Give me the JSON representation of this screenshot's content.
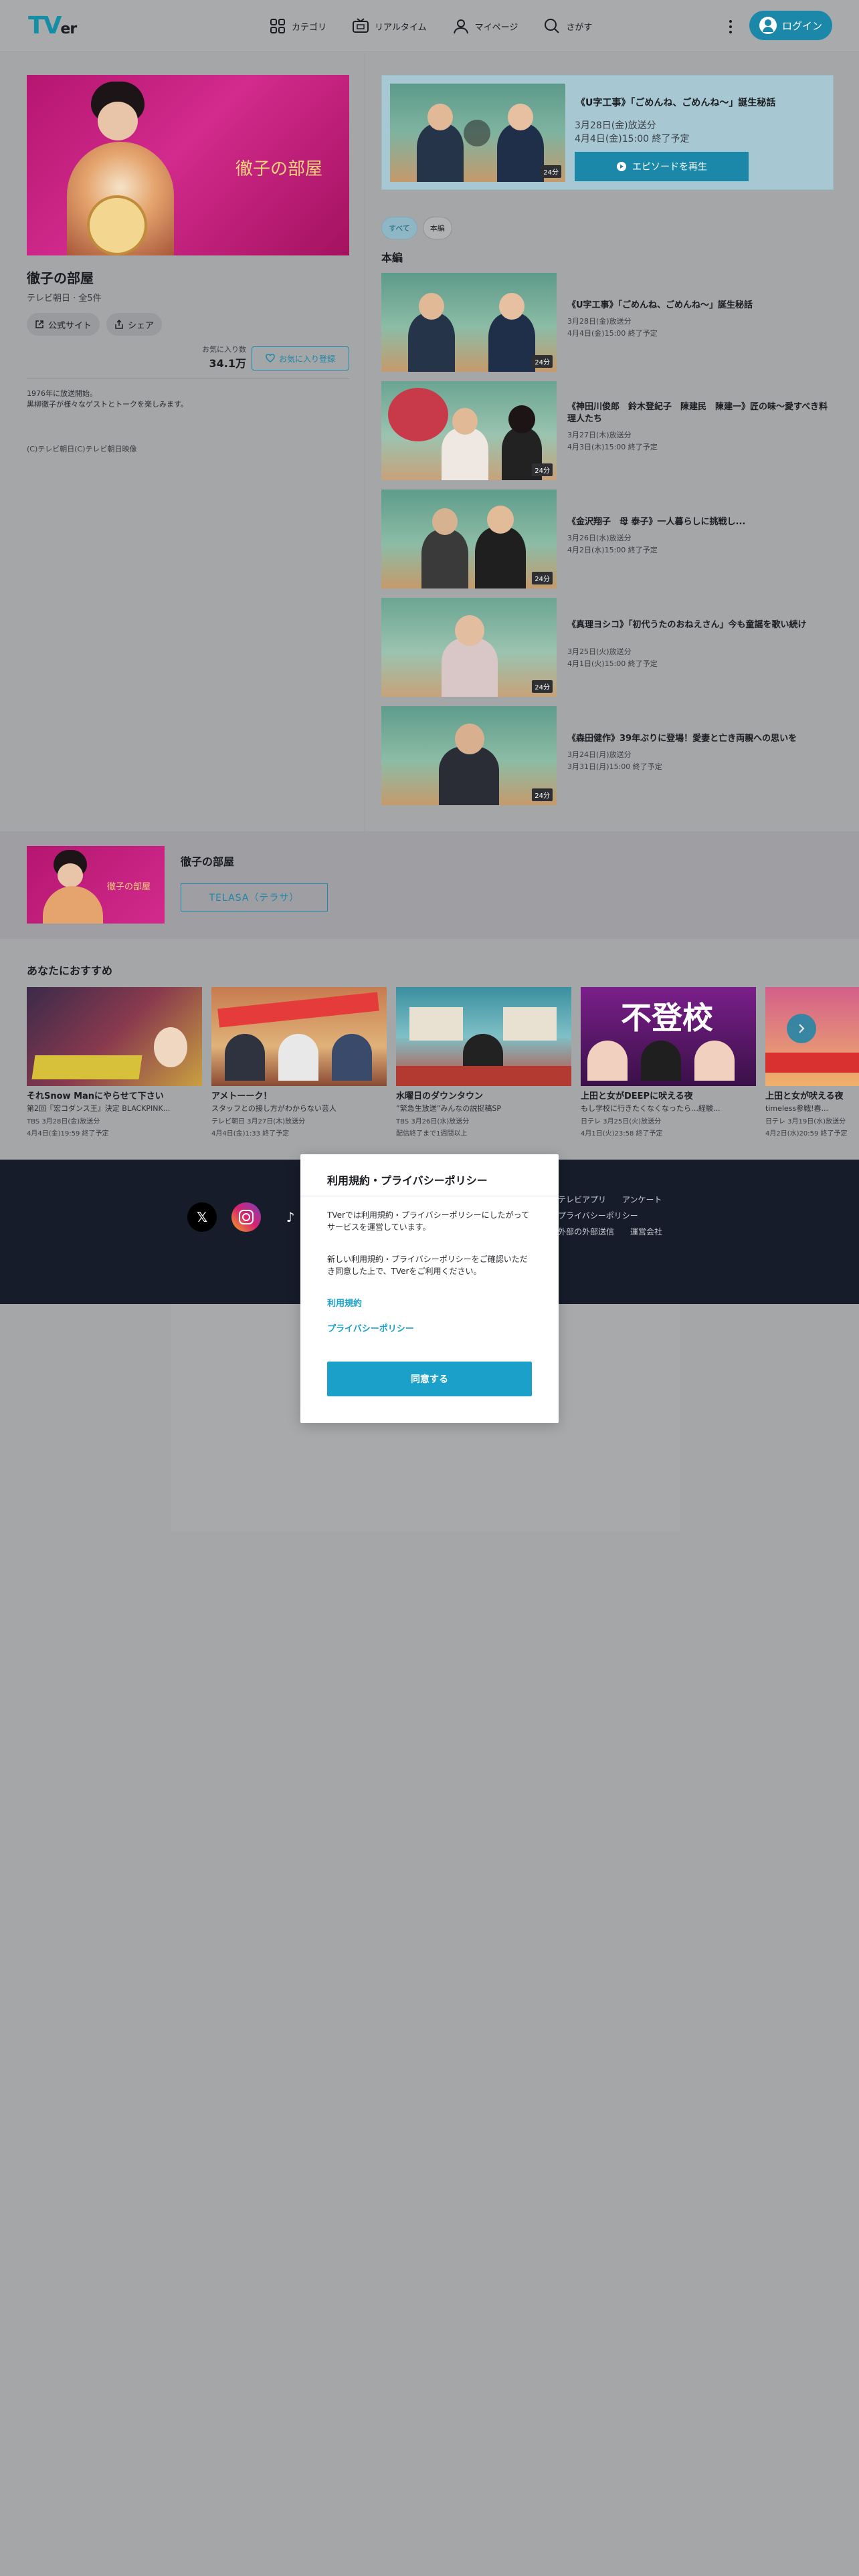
{
  "header": {
    "logo": "TV",
    "logo_tail": "er",
    "nav": [
      {
        "label": "カテゴリ",
        "icon": "category-icon"
      },
      {
        "label": "リアルタイム",
        "icon": "tv-icon"
      },
      {
        "label": "マイページ",
        "icon": "user-icon"
      },
      {
        "label": "さがす",
        "icon": "search-icon"
      }
    ],
    "login_label": "ログイン"
  },
  "program": {
    "hero_title": "徹子の部屋",
    "title": "徹子の部屋",
    "subtitle": "テレビ朝日 · 全5件",
    "official_label": "公式サイト",
    "share_label": "シェア",
    "fav_count_label": "お気に入り数",
    "fav_count": "34.1万",
    "fav_button": "お気に入り登録",
    "description_1": "1976年に放送開始。",
    "description_2": "黒柳徹子が様々なゲストとトークを楽しみます。",
    "copyright": "(C)テレビ朝日(C)テレビ朝日映像"
  },
  "feature": {
    "title": "《U字工事》「ごめんね、ごめんね〜」誕生秘話",
    "date1": "3月28日(金)放送分",
    "date2": "4月4日(金)15:00 終了予定",
    "play_label": "エピソードを再生",
    "duration": "24分"
  },
  "tabs": [
    {
      "label": "すべて"
    },
    {
      "label": "本編"
    }
  ],
  "section_title": "本編",
  "episodes": [
    {
      "title": "《U字工事》「ごめんね、ごめんね〜」誕生秘話",
      "date1": "3月28日(金)放送分",
      "date2": "4月4日(金)15:00 終了予定",
      "duration": "24分"
    },
    {
      "title": "《神田川俊郎　鈴木登紀子　陳建民　陳建一》匠の味〜愛すべき料理人たち",
      "date1": "3月27日(木)放送分",
      "date2": "4月3日(木)15:00 終了予定",
      "duration": "24分"
    },
    {
      "title": "《金沢翔子　母 泰子》一人暮らしに挑戦し...",
      "date1": "3月26日(水)放送分",
      "date2": "4月2日(水)15:00 終了予定",
      "duration": "24分"
    },
    {
      "title": "《真理ヨシコ》「初代うたのおねえさん」今も童謡を歌い続け",
      "date1": "3月25日(火)放送分",
      "date2": "4月1日(火)15:00 終了予定",
      "duration": "24分"
    },
    {
      "title": "《森田健作》39年ぶりに登場！愛妻と亡き両親への思いを",
      "date1": "3月24日(月)放送分",
      "date2": "3月31日(月)15:00 終了予定",
      "duration": "24分"
    }
  ],
  "telasa": {
    "name": "徹子の部屋",
    "button": "TELASA（テラサ）"
  },
  "recommend": {
    "heading": "あなたにおすすめ",
    "cards": [
      {
        "title": "それSnow Manにやらせて下さい",
        "sub": "第2回『宏コダンス王』決定 BLACKPINK...",
        "date1": "TBS 3月28日(金)放送分",
        "date2": "4月4日(金)19:59 終了予定"
      },
      {
        "title": "アメトーーク！",
        "sub": "スタッフとの接し方がわからない芸人",
        "date1": "テレビ朝日 3月27日(木)放送分",
        "date2": "4月4日(金)1:33 終了予定"
      },
      {
        "title": "水曜日のダウンタウン",
        "sub": "”緊急生放送”みんなの説捉稿SP",
        "date1": "TBS 3月26日(水)放送分",
        "date2": "配信終了まで1週間以上"
      },
      {
        "title": "上田と女がDEEPに吠える夜",
        "sub": "もし学校に行きたくなくなったら…経験...",
        "date1": "日テレ 3月25日(火)放送分",
        "date2": "4月1日(火)23:58 終了予定"
      },
      {
        "title": "上田と女が吠える夜",
        "sub": "timeless参戦!春...",
        "date1": "日テレ 3月19日(水)放送分",
        "date2": "4月2日(水)20:59 終了予定"
      }
    ]
  },
  "footer": {
    "links_1": "テレビアプリ",
    "links_2": "アンケート",
    "links_3": "プライバシーポリシー",
    "links_4": "外部の外部送信",
    "links_5": "運営会社",
    "social": [
      "x-icon",
      "instagram-icon",
      "tiktok-icon"
    ]
  },
  "modal": {
    "title": "利用規約・プライバシーポリシー",
    "p1": "TVerでは利用規約・プライバシーポリシーにしたがってサービスを運営しています。",
    "p2": "新しい利用規約・プライバシーポリシーをご確認いただき同意した上で、TVerをご利用ください。",
    "link_terms": "利用規約",
    "link_privacy": "プライバシーポリシー",
    "agree_button": "同意する"
  },
  "colors": {
    "accent": "#1ba0c9",
    "footer_bg": "#161c2a",
    "hero_pink": "#c8207e"
  }
}
